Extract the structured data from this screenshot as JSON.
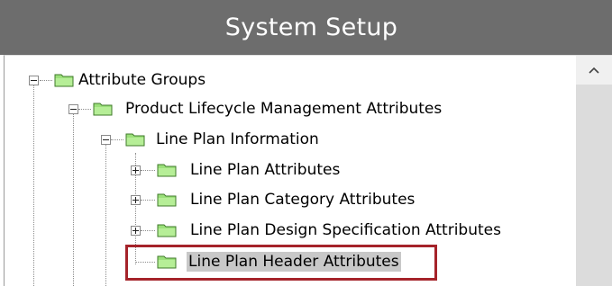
{
  "window": {
    "title": "System Setup"
  },
  "tree": {
    "root": {
      "label": "Attribute Groups",
      "expanded": true
    },
    "level1": {
      "label": "Product Lifecycle Management Attributes",
      "expanded": true
    },
    "level2": {
      "label": "Line Plan Information",
      "expanded": true
    },
    "children": [
      {
        "label": "Line Plan Attributes",
        "expanded": false
      },
      {
        "label": "Line Plan Category Attributes",
        "expanded": false
      },
      {
        "label": "Line Plan Design Specification Attributes",
        "expanded": false
      },
      {
        "label": "Line Plan Header Attributes",
        "selected": true
      }
    ]
  },
  "scrollbar": {
    "up_icon": "chevron-up-icon"
  },
  "colors": {
    "titlebar": "#6d6d6d",
    "folder": "#9be07a",
    "highlight": "#a5232a",
    "selection": "#c8c8c8"
  }
}
